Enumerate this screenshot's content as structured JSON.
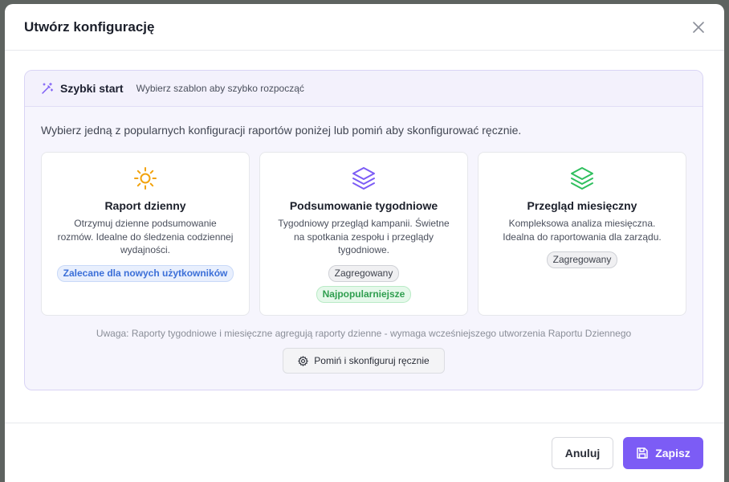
{
  "modal": {
    "title": "Utwórz konfigurację"
  },
  "quick_start": {
    "title": "Szybki start",
    "subtitle": "Wybierz szablon aby szybko rozpocząć",
    "intro": "Wybierz jedną z popularnych konfiguracji raportów poniżej lub pomiń aby skonfigurować ręcznie.",
    "cards": [
      {
        "icon": "sun-icon",
        "title": "Raport dzienny",
        "description": "Otrzymuj dzienne podsumowanie rozmów. Idealne do śledzenia codziennej wydajności.",
        "badges": [
          "Zalecane dla nowych użytkowników"
        ]
      },
      {
        "icon": "layers-icon",
        "title": "Podsumowanie tygodniowe",
        "description": "Tygodniowy przegląd kampanii. Świetne na spotkania zespołu i przeglądy tygodniowe.",
        "badges": [
          "Zagregowany",
          "Najpopularniejsze"
        ]
      },
      {
        "icon": "layers-icon",
        "title": "Przegląd miesięczny",
        "description": "Kompleksowa analiza miesięczna. Idealna do raportowania dla zarządu.",
        "badges": [
          "Zagregowany"
        ]
      }
    ],
    "note": "Uwaga: Raporty tygodniowe i miesięczne agregują raporty dzienne - wymaga wcześniejszego utworzenia Raportu Dziennego",
    "skip_label": "Pomiń i skonfiguruj ręcznie"
  },
  "footer": {
    "cancel_label": "Anuluj",
    "save_label": "Zapisz"
  },
  "colors": {
    "accent": "#7c5cf5",
    "sun": "#f2a20c",
    "weekly": "#7c5cf5",
    "monthly": "#2fbf5e"
  }
}
